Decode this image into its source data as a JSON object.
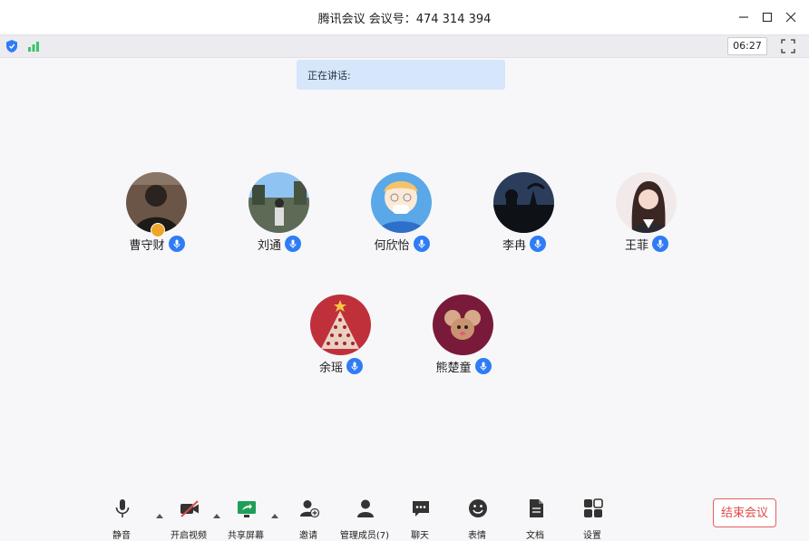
{
  "window": {
    "title": "腾讯会议 会议号：474 314 394",
    "timer": "06:27"
  },
  "speaking": {
    "label": "正在讲话:"
  },
  "participants": [
    {
      "name": "曹守财",
      "is_host": true
    },
    {
      "name": "刘通"
    },
    {
      "name": "何欣怡"
    },
    {
      "name": "李冉"
    },
    {
      "name": "王菲"
    },
    {
      "name": "余瑶"
    },
    {
      "name": "熊楚童"
    }
  ],
  "toolbar": {
    "mute": "静音",
    "video": "开启视频",
    "share": "共享屏幕",
    "invite": "邀请",
    "members": "管理成员(7)",
    "chat": "聊天",
    "reactions": "表情",
    "docs": "文档",
    "settings": "设置",
    "end": "结束会议"
  },
  "colors": {
    "accent": "#2f7cf6",
    "end_red": "#e24949",
    "speaking_bg": "#d6e6fb"
  }
}
